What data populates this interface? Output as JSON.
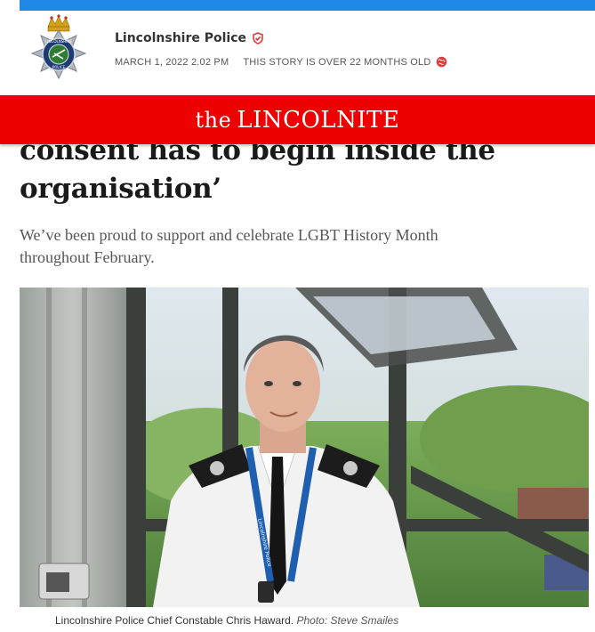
{
  "author": {
    "name": "Lincolnshire Police",
    "badge_text_top": "LINCOLNSHIRE",
    "badge_text_bottom": "POLICE"
  },
  "meta": {
    "date": "MARCH 1, 2022 2.02 PM",
    "age_notice": "THIS STORY IS OVER 22 MONTHS OLD"
  },
  "masthead": {
    "prefix": "the",
    "name": "LINCOLNITE"
  },
  "article": {
    "headline_lines": [
      "consent has to begin inside the",
      "organisation’"
    ],
    "standfirst": "We’ve been proud to support and celebrate LGBT History Month throughout February."
  },
  "photo": {
    "lanyard_text": "Lincolnshire Police"
  },
  "caption": {
    "text": "Lincolnshire Police Chief Constable Chris Haward.",
    "credit": "Photo: Steve Smailes"
  },
  "colors": {
    "top_bar": "#1e88e5",
    "masthead_bg": "#ee0000",
    "verified": "#e53935"
  }
}
